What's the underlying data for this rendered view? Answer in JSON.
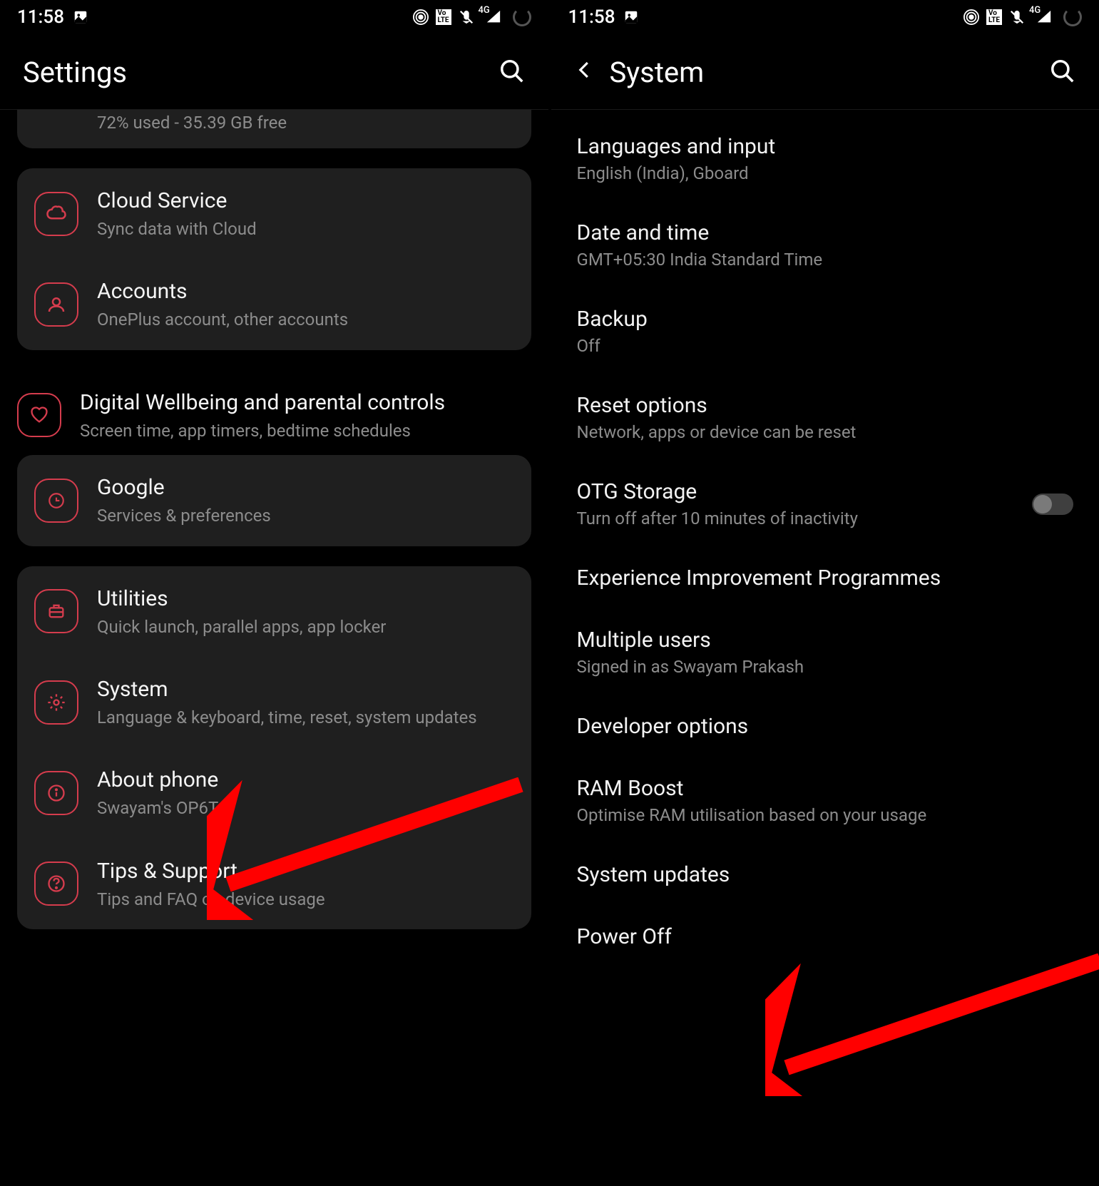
{
  "status": {
    "time": "11:58",
    "signal_label": "4G"
  },
  "left": {
    "title": "Settings",
    "storage_sub": "72% used - 35.39 GB free",
    "items": {
      "cloud": {
        "title": "Cloud Service",
        "sub": "Sync data with Cloud"
      },
      "accounts": {
        "title": "Accounts",
        "sub": "OnePlus account, other accounts"
      },
      "wellbeing": {
        "title": "Digital Wellbeing and parental controls",
        "sub": "Screen time, app timers, bedtime schedules"
      },
      "google": {
        "title": "Google",
        "sub": "Services & preferences"
      },
      "utilities": {
        "title": "Utilities",
        "sub": "Quick launch, parallel apps, app locker"
      },
      "system": {
        "title": "System",
        "sub": "Language & keyboard, time, reset, system updates"
      },
      "about": {
        "title": "About phone",
        "sub": "Swayam's OP6T"
      },
      "tips": {
        "title": "Tips & Support",
        "sub": "Tips and FAQ on device usage"
      }
    }
  },
  "right": {
    "title": "System",
    "items": {
      "lang": {
        "title": "Languages and input",
        "sub": "English (India), Gboard"
      },
      "date": {
        "title": "Date and time",
        "sub": "GMT+05:30 India Standard Time"
      },
      "backup": {
        "title": "Backup",
        "sub": "Off"
      },
      "reset": {
        "title": "Reset options",
        "sub": "Network, apps or device can be reset"
      },
      "otg": {
        "title": "OTG Storage",
        "sub": "Turn off after 10 minutes of inactivity"
      },
      "exp": {
        "title": "Experience Improvement Programmes"
      },
      "users": {
        "title": "Multiple users",
        "sub": "Signed in as Swayam Prakash"
      },
      "dev": {
        "title": "Developer options"
      },
      "ram": {
        "title": "RAM Boost",
        "sub": "Optimise RAM utilisation based on your usage"
      },
      "updates": {
        "title": "System updates"
      },
      "power": {
        "title": "Power Off"
      }
    }
  }
}
